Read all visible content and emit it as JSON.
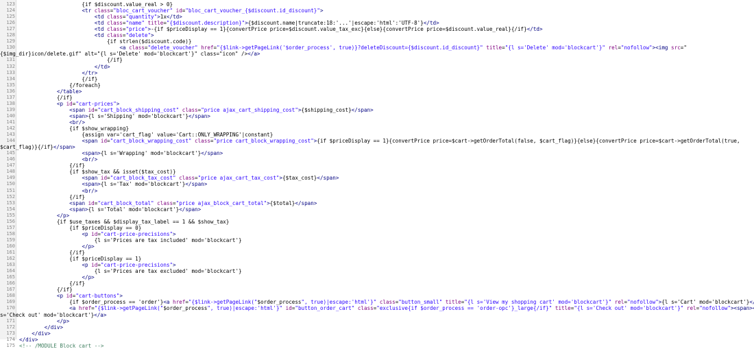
{
  "editor": {
    "lines": [
      {
        "n": "123",
        "text": "                    {if $discount.value_real > 0}"
      },
      {
        "n": "124",
        "text": "                    <tr class=\"bloc_cart_voucher\" id=\"bloc_cart_voucher_{$discount.id_discount}\">"
      },
      {
        "n": "125",
        "text": "                        <td class=\"quantity\">1x</td>"
      },
      {
        "n": "126",
        "text": "                        <td class=\"name\" title=\"{$discount.description}\">{$discount.name|truncate:18:'...'|escape:'html':'UTF-8'}</td>"
      },
      {
        "n": "127",
        "text": "                        <td class=\"price\">-{if $priceDisplay == 1}{convertPrice price=$discount.value_tax_exc}{else}{convertPrice price=$discount.value_real}{/if}</td>"
      },
      {
        "n": "128",
        "text": "                        <td class=\"delete\">"
      },
      {
        "n": "129",
        "text": "                            {if strlen($discount.code)}"
      },
      {
        "n": "130",
        "text": "                                <a class=\"delete_voucher\" href=\"{$link->getPageLink('$order_process', true)}?deleteDiscount={$discount.id_discount}\" title=\"{l s='Delete' mod='blockcart'}\" rel=\"nofollow\"><img src=\""
      },
      {
        "n": "",
        "text": "{$img_dir}icon/delete.gif\" alt=\"{l s='Delete' mod='blockcart'}\" class=\"icon\" /></a>",
        "wrap": true
      },
      {
        "n": "131",
        "text": "                            {/if}"
      },
      {
        "n": "132",
        "text": "                        </td>"
      },
      {
        "n": "133",
        "text": "                    </tr>"
      },
      {
        "n": "134",
        "text": "                    {/if}"
      },
      {
        "n": "135",
        "text": "                {/foreach}"
      },
      {
        "n": "136",
        "text": "            </table>"
      },
      {
        "n": "137",
        "text": "            {/if}"
      },
      {
        "n": "138",
        "text": "            <p id=\"cart-prices\">"
      },
      {
        "n": "139",
        "text": "                <span id=\"cart_block_shipping_cost\" class=\"price ajax_cart_shipping_cost\">{$shipping_cost}</span>"
      },
      {
        "n": "140",
        "text": "                <span>{l s='Shipping' mod='blockcart'}</span>"
      },
      {
        "n": "141",
        "text": "                <br/>"
      },
      {
        "n": "142",
        "text": "                {if $show_wrapping}"
      },
      {
        "n": "143",
        "text": "                    {assign var='cart_flag' value='Cart::ONLY_WRAPPING'|constant}"
      },
      {
        "n": "144",
        "text": "                    <span id=\"cart_block_wrapping_cost\" class=\"price cart_block_wrapping_cost\">{if $priceDisplay == 1}{convertPrice price=$cart->getOrderTotal(false, $cart_flag)}{else}{convertPrice price=$cart->getOrderTotal(true,"
      },
      {
        "n": "",
        "text": "$cart_flag)}{/if}</span>",
        "wrap": true
      },
      {
        "n": "145",
        "text": "                    <span>{l s='Wrapping' mod='blockcart'}</span>"
      },
      {
        "n": "146",
        "text": "                    <br/>"
      },
      {
        "n": "147",
        "text": "                {/if}"
      },
      {
        "n": "148",
        "text": "                {if $show_tax && isset($tax_cost)}"
      },
      {
        "n": "149",
        "text": "                    <span id=\"cart_block_tax_cost\" class=\"price ajax_cart_tax_cost\">{$tax_cost}</span>"
      },
      {
        "n": "150",
        "text": "                    <span>{l s='Tax' mod='blockcart'}</span>"
      },
      {
        "n": "151",
        "text": "                    <br/>"
      },
      {
        "n": "152",
        "text": "                {/if}"
      },
      {
        "n": "153",
        "text": "                <span id=\"cart_block_total\" class=\"price ajax_block_cart_total\">{$total}</span>"
      },
      {
        "n": "154",
        "text": "                <span>{l s='Total' mod='blockcart'}</span>"
      },
      {
        "n": "155",
        "text": "            </p>"
      },
      {
        "n": "156",
        "text": "            {if $use_taxes && $display_tax_label == 1 && $show_tax}"
      },
      {
        "n": "157",
        "text": "                {if $priceDisplay == 0}"
      },
      {
        "n": "158",
        "text": "                    <p id=\"cart-price-precisions\">"
      },
      {
        "n": "159",
        "text": "                        {l s='Prices are tax included' mod='blockcart'}"
      },
      {
        "n": "160",
        "text": "                    </p>"
      },
      {
        "n": "161",
        "text": "                {/if}"
      },
      {
        "n": "162",
        "text": "                {if $priceDisplay == 1}"
      },
      {
        "n": "163",
        "text": "                    <p id=\"cart-price-precisions\">"
      },
      {
        "n": "164",
        "text": "                        {l s='Prices are tax excluded' mod='blockcart'}"
      },
      {
        "n": "165",
        "text": "                    </p>"
      },
      {
        "n": "166",
        "text": "                {/if}"
      },
      {
        "n": "167",
        "text": "            {/if}"
      },
      {
        "n": "168",
        "text": "            <p id=\"cart-buttons\">"
      },
      {
        "n": "169",
        "text": "                {if $order_process == 'order'}<a href=\"{$link->getPageLink(\"$order_process\", true)|escape:'html'}\" class=\"button_small\" title=\"{l s='View my shopping cart' mod='blockcart'}\" rel=\"nofollow\">{l s='Cart' mod='blockcart'}</a>{/if}"
      },
      {
        "n": "170",
        "text": "                <a href=\"{$link->getPageLink(\"$order_process\", true)|escape:'html'}\" id=\"button_order_cart\" class=\"exclusive{if $order_process == 'order-opc'}_large{/if}\" title=\"{l s='Check out' mod='blockcart'}\" rel=\"nofollow\"><span></span>{l"
      },
      {
        "n": "",
        "text": "s='Check out' mod='blockcart'}</a>",
        "wrap": true
      },
      {
        "n": "171",
        "text": "            </p>"
      },
      {
        "n": "172",
        "text": "        </div>"
      },
      {
        "n": "173",
        "text": "    </div>"
      },
      {
        "n": "174",
        "text": "</div>"
      },
      {
        "n": "175",
        "text": "<!-- /MODULE Block cart -->"
      }
    ]
  }
}
